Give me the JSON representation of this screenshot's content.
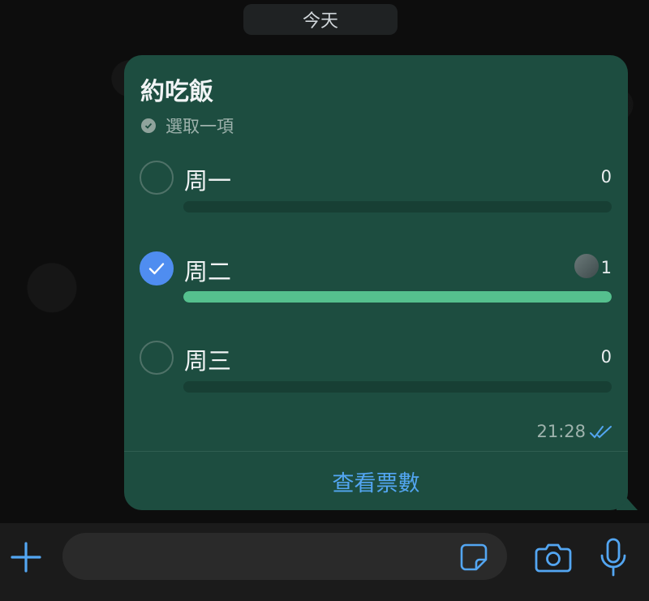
{
  "chat": {
    "date_chip": "今天"
  },
  "poll": {
    "title": "約吃飯",
    "hint": "選取一項",
    "options": [
      {
        "label": "周一",
        "count": "0",
        "selected": false,
        "fill": 0.0
      },
      {
        "label": "周二",
        "count": "1",
        "selected": true,
        "fill": 1.0
      },
      {
        "label": "周三",
        "count": "0",
        "selected": false,
        "fill": 0.0
      }
    ],
    "time": "21:28",
    "view_votes_label": "查看票數"
  },
  "input_bar": {
    "message_placeholder": ""
  },
  "colors": {
    "bubble": "#1d4d40",
    "accent_blue": "#4f8df0",
    "link_blue": "#53a6f2",
    "bar_fill": "#55c08e"
  },
  "icons": {
    "hint": "check-circle-icon",
    "read_receipt": "double-check-icon",
    "plus": "plus-icon",
    "sticker": "sticker-icon",
    "camera": "camera-icon",
    "mic": "microphone-icon"
  }
}
